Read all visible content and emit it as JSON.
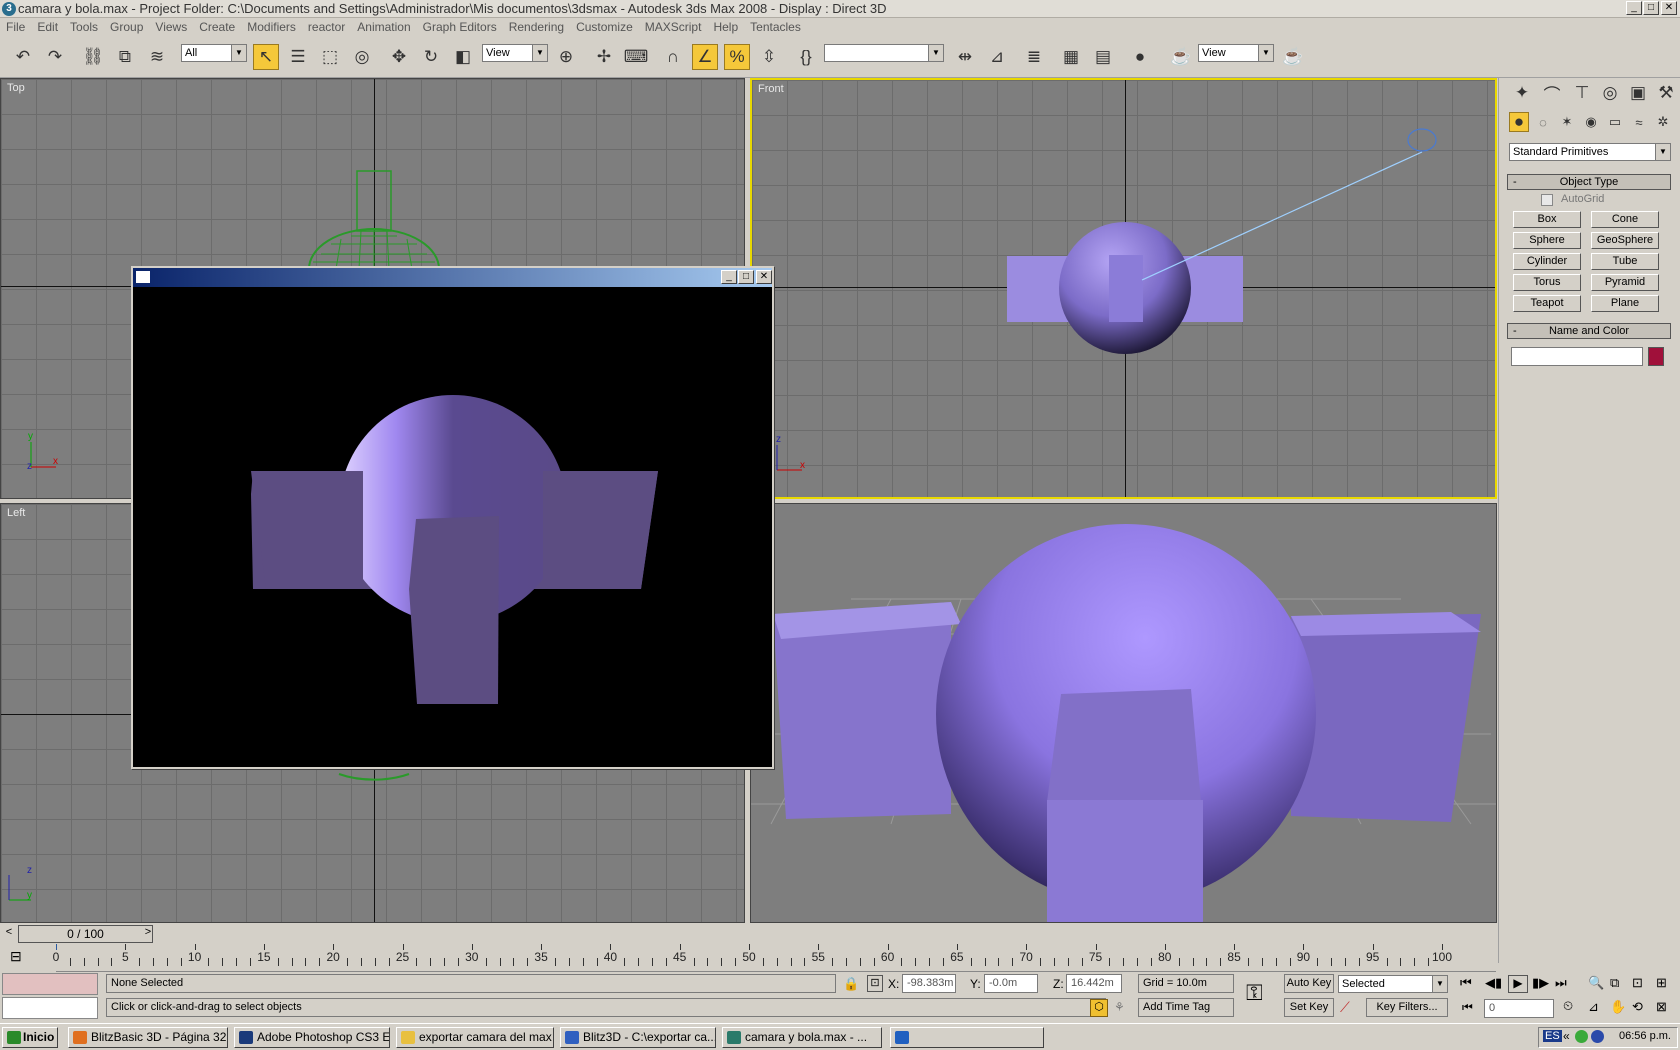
{
  "titlebar": {
    "title": "camara y bola.max     - Project Folder: C:\\Documents and Settings\\Administrador\\Mis documentos\\3dsmax     - Autodesk 3ds Max 2008      - Display : Direct 3D"
  },
  "menu": [
    "File",
    "Edit",
    "Tools",
    "Group",
    "Views",
    "Create",
    "Modifiers",
    "reactor",
    "Animation",
    "Graph Editors",
    "Rendering",
    "Customize",
    "MAXScript",
    "Help",
    "Tentacles"
  ],
  "toolbar": {
    "selection_filter": "All",
    "ref_coord": "View",
    "ref_coord2": "View",
    "named_sel": ""
  },
  "viewports": {
    "top": "Top",
    "front": "Front",
    "left": "Left"
  },
  "cmdpanel": {
    "category": "Standard Primitives",
    "object_type_header": "Object Type",
    "autogrid": "AutoGrid",
    "buttons": [
      "Box",
      "Cone",
      "Sphere",
      "GeoSphere",
      "Cylinder",
      "Tube",
      "Torus",
      "Pyramid",
      "Teapot",
      "Plane"
    ],
    "name_color_header": "Name and Color",
    "name_value": "",
    "color": "#a0103a"
  },
  "timeslider": {
    "label": "0 / 100",
    "ticks": [
      "0",
      "5",
      "10",
      "15",
      "20",
      "25",
      "30",
      "35",
      "40",
      "45",
      "50",
      "55",
      "60",
      "65",
      "70",
      "75",
      "80",
      "85",
      "90",
      "95",
      "100"
    ]
  },
  "status": {
    "selected": "None Selected",
    "prompt": "Click or click-and-drag to select objects",
    "x_label": "X:",
    "x_value": "-98.383m",
    "y_label": "Y:",
    "y_value": "-0.0m",
    "z_label": "Z:",
    "z_value": "16.442m",
    "grid": "Grid = 10.0m",
    "add_time_tag": "Add Time Tag",
    "auto_key": "Auto Key",
    "set_key": "Set Key",
    "key_mode": "Selected",
    "key_filters": "Key Filters...",
    "frame": "0"
  },
  "taskbar": {
    "start": "Inicio",
    "tasks": [
      "BlitzBasic 3D - Página 32 ...",
      "Adobe Photoshop CS3 E...",
      "exportar camara del max",
      "Blitz3D - C:\\exportar ca...",
      "camara y bola.max    - ...",
      ""
    ],
    "clock": "06:56 p.m."
  }
}
